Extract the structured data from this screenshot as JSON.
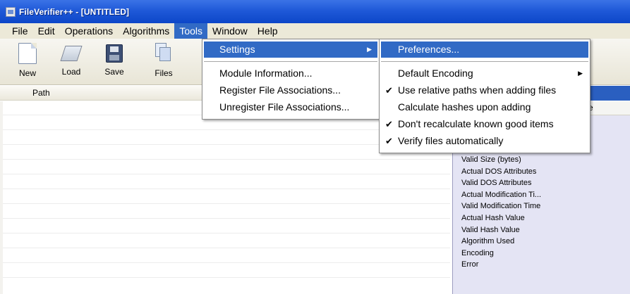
{
  "window": {
    "title": "FileVerifier++ - [UNTITLED]"
  },
  "menubar": {
    "items": [
      {
        "label": "File"
      },
      {
        "label": "Edit"
      },
      {
        "label": "Operations"
      },
      {
        "label": "Algorithms"
      },
      {
        "label": "Tools",
        "active": true
      },
      {
        "label": "Window"
      },
      {
        "label": "Help"
      }
    ]
  },
  "toolbar": {
    "buttons": [
      {
        "label": "New",
        "icon": "new-document-icon"
      },
      {
        "label": "Load",
        "icon": "open-folder-icon"
      },
      {
        "label": "Save",
        "icon": "floppy-disk-icon"
      },
      {
        "label": "Files",
        "icon": "add-files-icon"
      }
    ]
  },
  "table": {
    "columns": [
      {
        "label": "Path"
      }
    ]
  },
  "tools_menu": {
    "items": [
      {
        "label": "Settings",
        "submenu": true,
        "highlighted": true
      },
      {
        "label": "Module Information..."
      },
      {
        "label": "Register File Associations..."
      },
      {
        "label": "Unregister File Associations..."
      }
    ]
  },
  "settings_menu": {
    "items": [
      {
        "label": "Preferences...",
        "highlighted": true,
        "checked": false
      },
      {
        "label": "Default Encoding",
        "submenu": true,
        "checked": false
      },
      {
        "label": "Use relative paths when adding files",
        "checked": true
      },
      {
        "label": "Calculate hashes upon adding",
        "checked": false
      },
      {
        "label": "Don't recalculate known good items",
        "checked": true
      },
      {
        "label": "Verify files automatically",
        "checked": true
      }
    ]
  },
  "right_panel": {
    "header_fragment": "e",
    "items": [
      "Valid Size (bytes)",
      "Actual DOS Attributes",
      "Valid DOS Attributes",
      "Actual Modification Ti...",
      "Valid Modification Time",
      "Actual Hash Value",
      "Valid Hash Value",
      "Algorithm Used",
      "Encoding",
      "Error"
    ]
  },
  "colors": {
    "titlebar": "#1f59d8",
    "highlight": "#316ac5",
    "menubar": "#ece9d8",
    "right_panel": "#e4e4f4"
  }
}
